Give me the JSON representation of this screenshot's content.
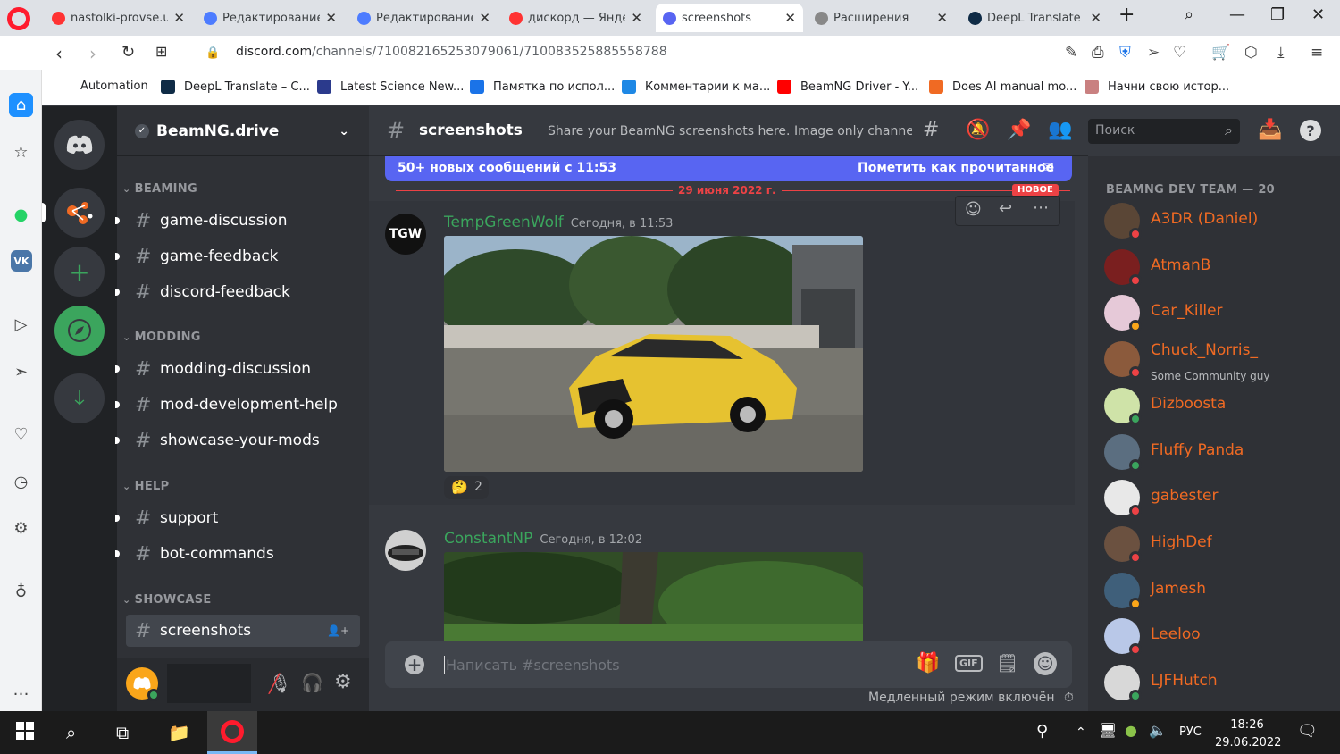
{
  "browser": {
    "tabs": [
      {
        "title": "nastolki-provse.u",
        "favicon": "yandex-icon",
        "color": "#ff3333",
        "active": false
      },
      {
        "title": "Редактирование",
        "favicon": "gear-icon",
        "color": "#4d7cff",
        "active": false
      },
      {
        "title": "Редактирование",
        "favicon": "gear-icon",
        "color": "#4d7cff",
        "active": false
      },
      {
        "title": "дискорд — Яндек",
        "favicon": "yandex-icon",
        "color": "#ff3333",
        "active": false
      },
      {
        "title": "screenshots",
        "favicon": "discord-icon",
        "color": "#5865f2",
        "active": true
      },
      {
        "title": "Расширения",
        "favicon": "cube-icon",
        "color": "#888888",
        "active": false
      },
      {
        "title": "DeepL Translate -",
        "favicon": "deepl-icon",
        "color": "#0f2b46",
        "active": false
      }
    ],
    "url_domain": "discord.com",
    "url_path": "/channels/710082165253079061/710083525885558788",
    "bookmarks": [
      {
        "label": "Automation",
        "color": ""
      },
      {
        "label": "DeepL Translate – C...",
        "color": "#0f2b46"
      },
      {
        "label": "Latest Science New...",
        "color": "#2b3a8c"
      },
      {
        "label": "Памятка по испол...",
        "color": "#1a73e8"
      },
      {
        "label": "Комментарии к ма...",
        "color": "#1e88e5"
      },
      {
        "label": "BeamNG Driver - Y...",
        "color": "#ff0000"
      },
      {
        "label": "Does AI manual mo...",
        "color": "#f06a23"
      },
      {
        "label": "Начни свою истор...",
        "color": "#c98080"
      }
    ]
  },
  "server": {
    "name": "BeamNG.drive"
  },
  "categories": [
    {
      "name": "BEAMING",
      "channels": [
        "game-discussion",
        "game-feedback",
        "discord-feedback"
      ]
    },
    {
      "name": "MODDING",
      "channels": [
        "modding-discussion",
        "mod-development-help",
        "showcase-your-mods"
      ]
    },
    {
      "name": "HELP",
      "channels": [
        "support",
        "bot-commands"
      ]
    },
    {
      "name": "SHOWCASE",
      "channels": [
        "screenshots"
      ]
    }
  ],
  "header": {
    "channel": "screenshots",
    "topic": "Share your BeamNG screenshots here. Image only channe...",
    "search_placeholder": "Поиск"
  },
  "banner": {
    "text": "50+ новых сообщений с 11:53",
    "action": "Пометить как прочитанное"
  },
  "divider": {
    "date": "29 июня 2022 г.",
    "badge": "НОВОЕ"
  },
  "messages": [
    {
      "author": "TempGreenWolf",
      "time": "Сегодня, в 11:53",
      "avatar_text": "TGW",
      "name_color": "#3ba55d",
      "reaction_count": "2",
      "reaction_emoji": "🤔"
    },
    {
      "author": "ConstantNP",
      "time": "Сегодня, в 12:02",
      "avatar_text": "",
      "name_color": "#3ba55d"
    }
  ],
  "composer": {
    "placeholder": "Написать #screenshots"
  },
  "slowmode": "Медленный режим включён",
  "members": {
    "group": "BEAMNG DEV TEAM — 20",
    "list": [
      {
        "name": "A3DR (Daniel)",
        "status": "dnd",
        "sub": ""
      },
      {
        "name": "AtmanB",
        "status": "dnd",
        "sub": ""
      },
      {
        "name": "Car_Killer",
        "status": "idle",
        "sub": ""
      },
      {
        "name": "Chuck_Norris_",
        "status": "dnd",
        "sub": "Some Community guy"
      },
      {
        "name": "Dizboosta",
        "status": "online",
        "sub": ""
      },
      {
        "name": "Fluffy Panda",
        "status": "online",
        "sub": ""
      },
      {
        "name": "gabester",
        "status": "dnd",
        "sub": ""
      },
      {
        "name": "HighDef",
        "status": "dnd",
        "sub": ""
      },
      {
        "name": "Jamesh",
        "status": "idle",
        "sub": ""
      },
      {
        "name": "Leeloo",
        "status": "dnd",
        "sub": ""
      },
      {
        "name": "LJFHutch",
        "status": "online",
        "sub": ""
      }
    ]
  },
  "taskbar": {
    "lang": "РУС",
    "time": "18:26",
    "date": "29.06.2022"
  }
}
